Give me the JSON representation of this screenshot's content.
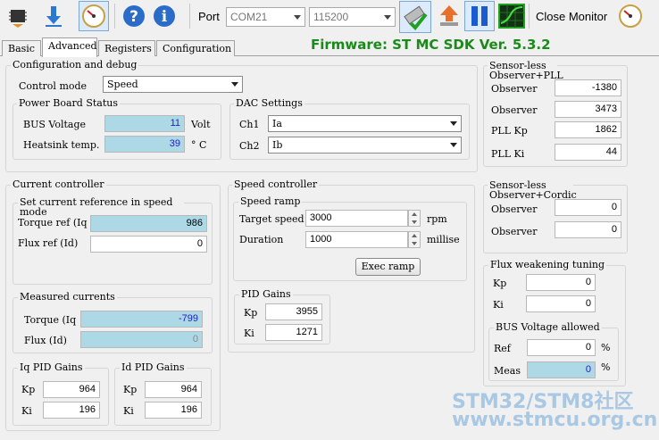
{
  "toolbar": {
    "port_label": "Port",
    "port_value": "COM21",
    "baud_value": "115200",
    "close_monitor_label": "Close Monitor",
    "icons": [
      "chip-icon",
      "download-icon",
      "gauge-icon",
      "help-icon",
      "info-icon",
      "connect-icon",
      "upload-icon",
      "pause-icon",
      "chart-icon",
      "gauge-icon"
    ]
  },
  "tabs": [
    "Basic",
    "Advanced",
    "Registers",
    "Configuration"
  ],
  "firmware": "Firmware: ST MC SDK Ver. 5.3.2",
  "config": {
    "title": "Configuration and debug",
    "control_mode_label": "Control mode",
    "control_mode_value": "Speed"
  },
  "power_board": {
    "title": "Power Board Status",
    "bus_voltage_label": "BUS Voltage",
    "bus_voltage_value": "11",
    "bus_voltage_unit": "Volt",
    "heatsink_label": "Heatsink temp.",
    "heatsink_value": "39",
    "heatsink_unit": "° C"
  },
  "dac": {
    "title": "DAC Settings",
    "ch1_label": "Ch1",
    "ch1_value": "Ia",
    "ch2_label": "Ch2",
    "ch2_value": "Ib"
  },
  "current_controller": {
    "title": "Current controller",
    "ref_title": "Set current reference in speed mode",
    "torque_ref_label": "Torque ref (Iq",
    "torque_ref_value": "986",
    "flux_ref_label": "Flux ref (Id)",
    "flux_ref_value": "0",
    "measured_title": "Measured currents",
    "torque_label": "Torque (Iq",
    "torque_value": "-799",
    "flux_label": "Flux (Id)",
    "flux_value": "0",
    "iq_pid_title": "Iq PID Gains",
    "iq_kp_label": "Kp",
    "iq_kp_value": "964",
    "iq_ki_label": "Ki",
    "iq_ki_value": "196",
    "id_pid_title": "Id PID Gains",
    "id_kp_label": "Kp",
    "id_kp_value": "964",
    "id_ki_label": "Ki",
    "id_ki_value": "196"
  },
  "speed_controller": {
    "title": "Speed controller",
    "ramp_title": "Speed ramp",
    "target_label": "Target speed",
    "target_value": "3000",
    "target_unit": "rpm",
    "duration_label": "Duration",
    "duration_value": "1000",
    "duration_unit": "millise",
    "exec_button": "Exec ramp",
    "pid_title": "PID Gains",
    "kp_label": "Kp",
    "kp_value": "3955",
    "ki_label": "Ki",
    "ki_value": "1271"
  },
  "observer_pll": {
    "title": "Sensor-less Observer+PLL",
    "observer1_label": "Observer",
    "observer1_value": "-1380",
    "observer2_label": "Observer",
    "observer2_value": "3473",
    "pll_kp_label": "PLL Kp",
    "pll_kp_value": "1862",
    "pll_ki_label": "PLL Ki",
    "pll_ki_value": "44"
  },
  "observer_cordic": {
    "title": "Sensor-less Observer+Cordic",
    "observer1_label": "Observer",
    "observer1_value": "0",
    "observer2_label": "Observer",
    "observer2_value": "0"
  },
  "flux_weakening": {
    "title": "Flux weakening tuning",
    "kp_label": "Kp",
    "kp_value": "0",
    "ki_label": "Ki",
    "ki_value": "0",
    "bus_title": "BUS Voltage allowed",
    "ref_label": "Ref",
    "ref_value": "0",
    "ref_unit": "%",
    "meas_label": "Meas",
    "meas_value": "0",
    "meas_unit": "%"
  },
  "watermark": {
    "line1": "STM32/STM8社区",
    "line2": "www.stmcu.org.cn"
  }
}
